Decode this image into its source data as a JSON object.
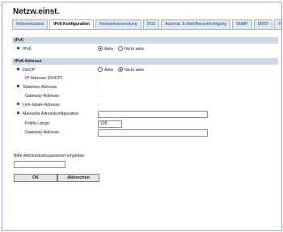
{
  "window": {
    "title": "Netzw.einst."
  },
  "tabs": [
    {
      "label": "Netzwerkstatus"
    },
    {
      "label": "IPv6-Konfiguration"
    },
    {
      "label": "Netzwerkanwendung"
    },
    {
      "label": "DNS"
    },
    {
      "label": "Automat. E-Mail-Benachrichtigung"
    },
    {
      "label": "SNMP"
    },
    {
      "label": "SMTP"
    },
    {
      "label": "PO"
    }
  ],
  "active_tab": "IPv6-Konfiguration",
  "ipv6_section": {
    "heading": "IPv6",
    "ipv6_label": "IPv6",
    "ipv6_options": {
      "on": "Aktiv",
      "off": "Nicht aktiv",
      "selected": "Aktiv"
    }
  },
  "address_section": {
    "heading": "IPv6-Adresse",
    "dhcp_label": "DHCP",
    "dhcp_options": {
      "on": "Aktiv",
      "off": "Nicht aktiv",
      "selected": "Nicht aktiv"
    },
    "ip_dhcp_label": "IP-Adresse (DHCP)",
    "ip_dhcp_value": ":",
    "stateless_label": "Stateless Adresse",
    "stateless_value": ":",
    "gateway_label": "Gateway-Adresse",
    "gateway_value": ":",
    "link_local_label": "Link-lokale Adresse",
    "link_local_value": ":",
    "manual_label": "Manuelle Adresskonfiguration",
    "manual_value": "",
    "prefix_label": "Präfix-Länge",
    "prefix_value": "128",
    "gateway2_label": "Gateway-Adresse",
    "gateway2_value": ""
  },
  "admin": {
    "prompt": "Bitte Administratorpasswort eingeben.",
    "password_value": ""
  },
  "buttons": {
    "ok": "OK",
    "cancel": "Abbrechen"
  },
  "colors": {
    "section_bg": "#cdd8e4",
    "tab_bg": "#dfe6ee",
    "bullet": "#2f5d8a"
  }
}
